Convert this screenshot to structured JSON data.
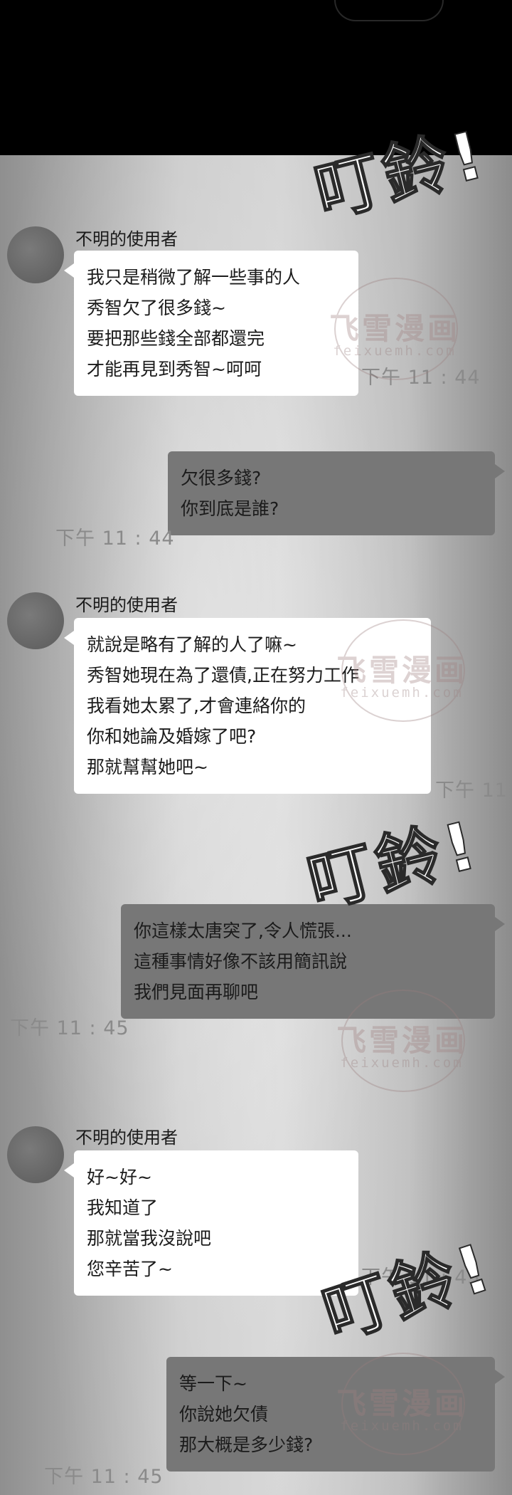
{
  "sfx": {
    "ding": "叮鈴!"
  },
  "watermark": {
    "title": "飞雪漫画",
    "url": "feixuemh.com"
  },
  "messages": [
    {
      "sender": "不明的使用者",
      "lines": [
        "我只是稍微了解一些事的人",
        "秀智欠了很多錢~",
        "要把那些錢全部都還完",
        "才能再見到秀智~呵呵"
      ],
      "time": "下午 11 : 44"
    },
    {
      "lines": [
        "欠很多錢?",
        "你到底是誰?"
      ],
      "time": "下午 11 : 44"
    },
    {
      "sender": "不明的使用者",
      "lines": [
        "就說是略有了解的人了嘛~",
        "秀智她現在為了還債,正在努力工作",
        "我看她太累了,才會連絡你的",
        "你和她論及婚嫁了吧?",
        "那就幫幫她吧~"
      ],
      "time": "下午 11"
    },
    {
      "lines": [
        "你這樣太唐突了,令人慌張...",
        "這種事情好像不該用簡訊說",
        "我們見面再聊吧"
      ],
      "time": "下午 11 : 45"
    },
    {
      "sender": "不明的使用者",
      "lines": [
        "好~好~",
        "我知道了",
        "那就當我沒說吧",
        "您辛苦了~"
      ],
      "time": "下午 11 : 45"
    },
    {
      "lines": [
        "等一下~",
        "你說她欠債",
        "那大概是多少錢?"
      ],
      "time": "下午 11 : 45"
    }
  ]
}
